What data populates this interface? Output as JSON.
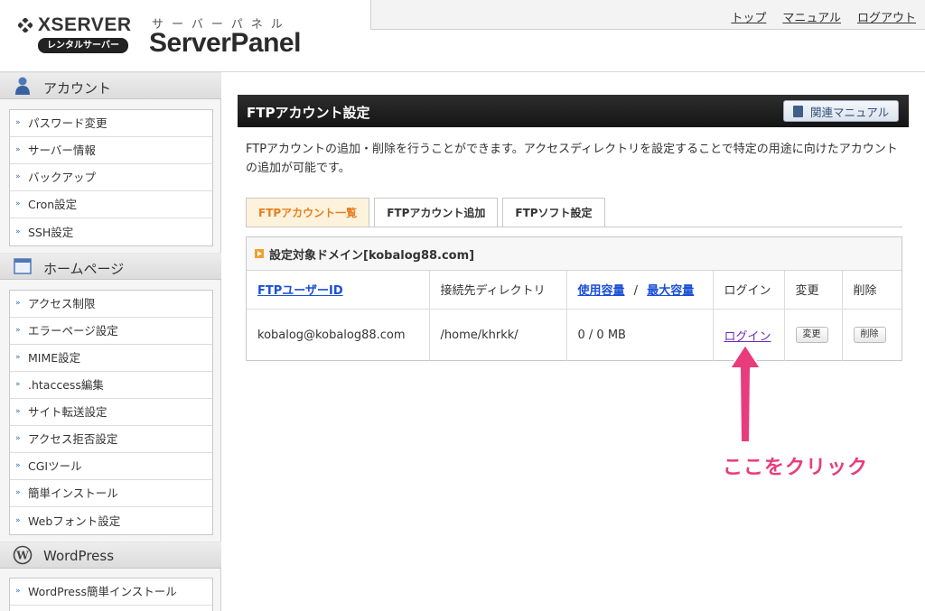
{
  "header": {
    "brand": "XSERVER",
    "badge": "レンタルサーバー",
    "kana": "サーバーパネル",
    "product": "ServerPanel",
    "links": [
      "トップ",
      "マニュアル",
      "ログアウト"
    ]
  },
  "sidebar": {
    "sections": [
      {
        "title": "アカウント",
        "icon": "user-icon",
        "items": [
          "パスワード変更",
          "サーバー情報",
          "バックアップ",
          "Cron設定",
          "SSH設定"
        ]
      },
      {
        "title": "ホームページ",
        "icon": "window-icon",
        "items": [
          "アクセス制限",
          "エラーページ設定",
          "MIME設定",
          ".htaccess編集",
          "サイト転送設定",
          "アクセス拒否設定",
          "CGIツール",
          "簡単インストール",
          "Webフォント設定"
        ]
      },
      {
        "title": "WordPress",
        "icon": "wordpress-icon",
        "items": [
          "WordPress簡単インストール"
        ]
      }
    ]
  },
  "main": {
    "title": "FTPアカウント設定",
    "manual_button": "関連マニュアル",
    "description": "FTPアカウントの追加・削除を行うことができます。アクセスディレクトリを設定することで特定の用途に向けたアカウントの追加が可能です。",
    "tabs": [
      "FTPアカウント一覧",
      "FTPアカウント追加",
      "FTPソフト設定"
    ],
    "domain_label": "設定対象ドメイン[kobalog88.com]",
    "table": {
      "headers": {
        "user_id": "FTPユーザーID",
        "directory": "接続先ディレクトリ",
        "used": "使用容量",
        "sep": "/",
        "max": "最大容量",
        "login": "ログイン",
        "change": "変更",
        "delete": "削除"
      },
      "rows": [
        {
          "user_id": "kobalog@kobalog88.com",
          "directory": "/home/khrkk/",
          "capacity": "0 / 0 MB",
          "login": "ログイン",
          "change": "変更",
          "delete": "削除"
        }
      ]
    }
  },
  "annotation": {
    "text": "ここをクリック",
    "color": "#e93c7c"
  }
}
